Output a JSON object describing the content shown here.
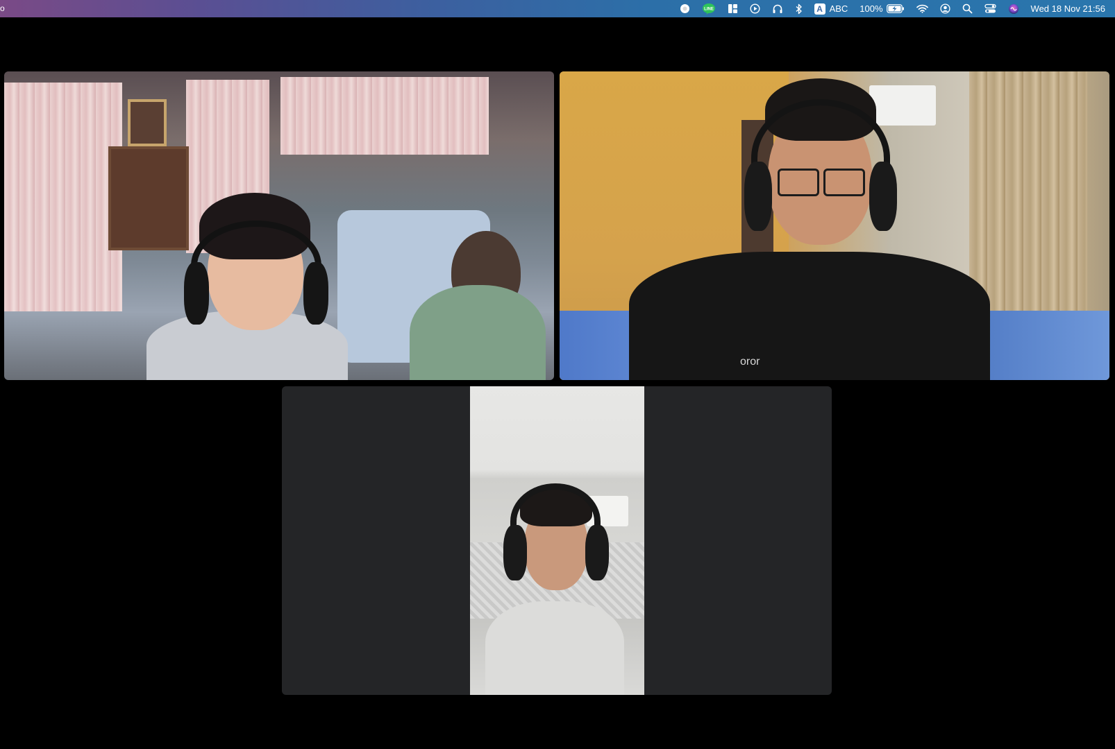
{
  "menubar": {
    "left_glyph": "o",
    "input_source": "ABC",
    "battery_percent": "100%",
    "datetime": "Wed 18 Nov  21:56",
    "icons": [
      "circle-status-icon",
      "line-app-icon",
      "window-manager-icon",
      "play-icon",
      "headphones-icon",
      "bluetooth-icon",
      "input-source-icon",
      "battery-icon",
      "wifi-icon",
      "user-account-icon",
      "spotlight-search-icon",
      "control-center-icon",
      "siri-icon"
    ]
  },
  "call": {
    "participants": [
      {
        "id": "participant-1"
      },
      {
        "id": "participant-2"
      },
      {
        "id": "participant-3"
      }
    ],
    "shirt_text": "oror"
  },
  "colors": {
    "background": "#000000",
    "tile_empty": "#242527",
    "menubar_start": "#7a4a86",
    "menubar_end": "#2a76ad"
  }
}
